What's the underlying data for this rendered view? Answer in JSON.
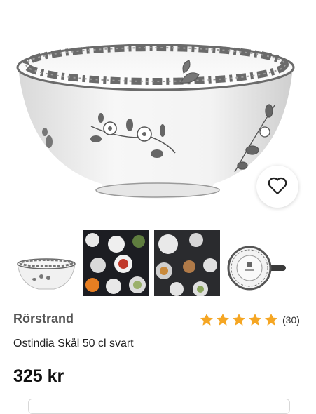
{
  "product": {
    "brand": "Rörstrand",
    "name": "Ostindia Skål 50 cl svart",
    "price": "325 kr",
    "rating": {
      "value": 5,
      "max": 5,
      "count_label": "(30)"
    }
  },
  "icons": {
    "favorite": "heart-outline-icon",
    "star": "star-icon"
  },
  "colors": {
    "star": "#f5a623",
    "pattern": "#555555",
    "text": "#1e1e1e"
  }
}
